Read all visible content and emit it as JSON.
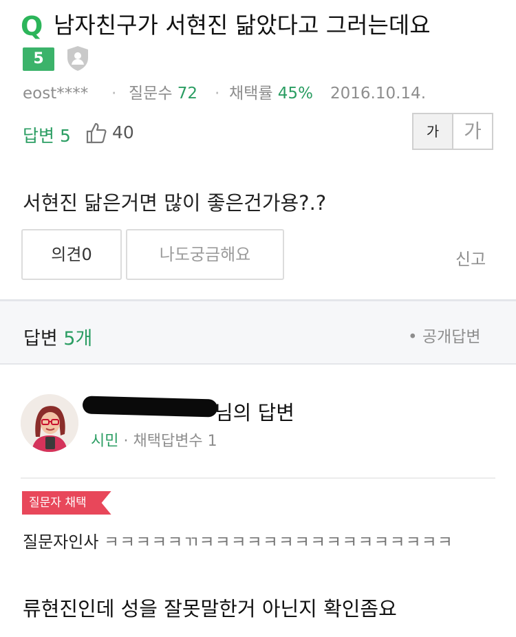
{
  "question": {
    "mark": "Q",
    "title": "남자친구가 서현진 닮았다고 그러는데요",
    "level": "5",
    "author": "eost****",
    "question_count_label": "질문수",
    "question_count": "72",
    "accept_rate_label": "채택률",
    "accept_rate": "45%",
    "date": "2016.10.14.",
    "answer_count_label": "답변 5",
    "like_count": "40",
    "font_small": "가",
    "font_large": "가",
    "body": "서현진 닮은거면 많이 좋은건가용?.?",
    "opinion_button": "의견0",
    "curious_button": "나도궁금해요",
    "report_link": "신고"
  },
  "answers_section": {
    "title_prefix": "답변",
    "title_count": "5개",
    "public_answer": "• 공개답변"
  },
  "answer": {
    "author_suffix": "님의 답변",
    "author_level": "시민",
    "adopted_count_label": "· 채택답변수 1",
    "tag": "질문자 채택",
    "thanks_label": "질문자인사",
    "thanks_text": "ㅋㅋㅋㅋㅋㄲㅋㅋㅋㅋㅋㅋㅋㅋㅋㅋㅋㅋㅋㅋㅋㅋ",
    "body": "류현진인데 성을 잘못말한거 아닌지 확인좀요"
  },
  "colors": {
    "accent_green": "#2cb55a",
    "badge_green": "#3bb36a",
    "tag_red": "#e8475a"
  },
  "icons": [
    "q-icon",
    "shield-icon",
    "thumbs-up-icon",
    "avatar-icon"
  ]
}
